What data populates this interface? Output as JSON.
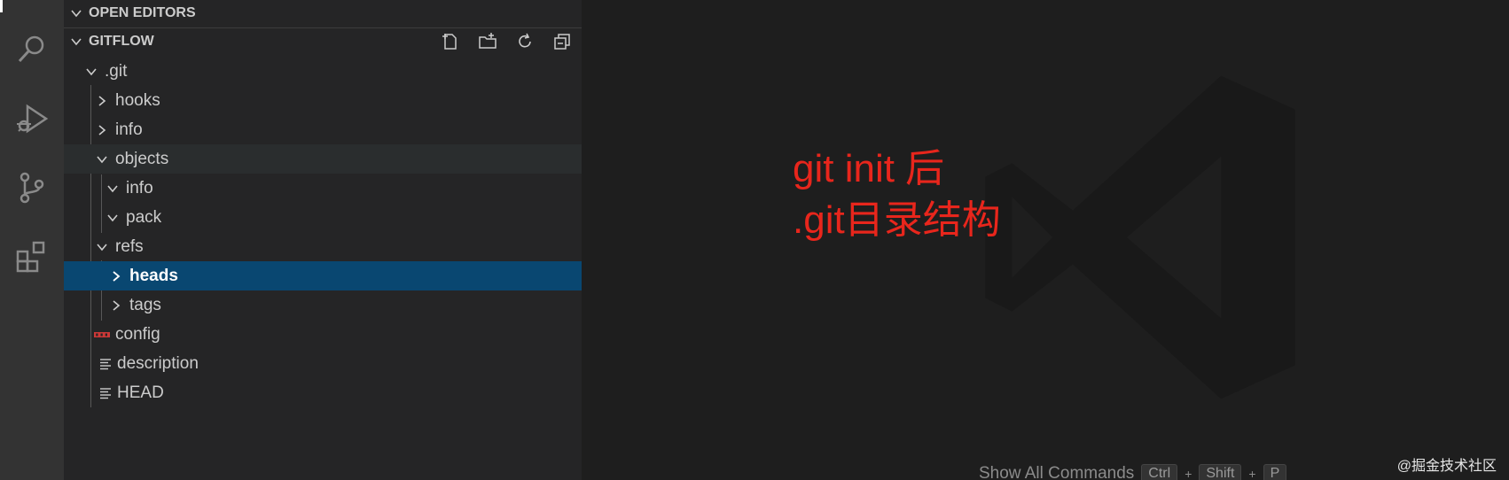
{
  "activity_bar": {
    "icons": [
      "search-icon",
      "run-debug-icon",
      "source-control-icon",
      "extensions-icon"
    ]
  },
  "explorer": {
    "open_editors_label": "OPEN EDITORS",
    "workspace_label": "GITFLOW",
    "actions": [
      "new-file-icon",
      "new-folder-icon",
      "refresh-icon",
      "collapse-all-icon"
    ],
    "tree": [
      {
        "label": ".git",
        "type": "folder",
        "expanded": true
      },
      {
        "label": "hooks",
        "type": "folder",
        "expanded": false
      },
      {
        "label": "info",
        "type": "folder",
        "expanded": false
      },
      {
        "label": "objects",
        "type": "folder",
        "expanded": true,
        "state": "hover"
      },
      {
        "label": "info",
        "type": "folder",
        "expanded": true
      },
      {
        "label": "pack",
        "type": "folder",
        "expanded": true
      },
      {
        "label": "refs",
        "type": "folder",
        "expanded": true
      },
      {
        "label": "heads",
        "type": "folder",
        "expanded": false,
        "state": "selected"
      },
      {
        "label": "tags",
        "type": "folder",
        "expanded": false
      },
      {
        "label": "config",
        "type": "file",
        "icon": "npm-icon"
      },
      {
        "label": "description",
        "type": "file",
        "icon": "lines-icon"
      },
      {
        "label": "HEAD",
        "type": "file",
        "icon": "lines-icon"
      }
    ]
  },
  "editor": {
    "annotation_line1": "git init 后",
    "annotation_line2": ".git目录结构",
    "annotation_color": "#e8261c",
    "shortcut_label": "Show All Commands",
    "keys": [
      "Ctrl",
      "Shift",
      "P"
    ],
    "key_separator": "+"
  },
  "credit": "@掘金技术社区",
  "colors": {
    "selected": "#094771",
    "sidebar": "#252526",
    "activity": "#333333",
    "editor": "#1e1e1e"
  }
}
